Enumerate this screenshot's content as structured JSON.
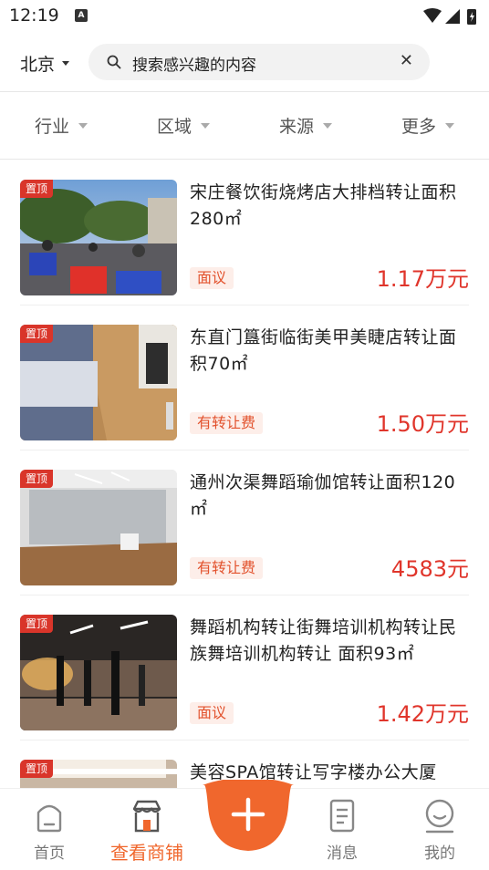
{
  "status_bar": {
    "time": "12:19",
    "notification_icon": "A"
  },
  "header": {
    "city": "北京",
    "search": {
      "value": "搜索感兴趣的内容"
    }
  },
  "filters": [
    "行业",
    "区域",
    "来源",
    "更多"
  ],
  "listings": [
    {
      "badge": "置顶",
      "title": "宋庄餐饮街烧烤店大排档转让面积280㎡",
      "tag": "面议",
      "price_num": "1.17",
      "price_unit": "万元"
    },
    {
      "badge": "置顶",
      "title": "东直门簋街临街美甲美睫店转让面积70㎡",
      "tag": "有转让费",
      "price_num": "1.50",
      "price_unit": "万元"
    },
    {
      "badge": "置顶",
      "title": "通州次渠舞蹈瑜伽馆转让面积120㎡",
      "tag": "有转让费",
      "price_num": "4583",
      "price_unit": "元"
    },
    {
      "badge": "置顶",
      "title": "舞蹈机构转让街舞培训机构转让民族舞培训机构转让 面积93㎡",
      "tag": "面议",
      "price_num": "1.42",
      "price_unit": "万元"
    },
    {
      "badge": "置顶",
      "title": "美容SPA馆转让写字楼办公大厦",
      "tag": "",
      "price_num": "",
      "price_unit": ""
    }
  ],
  "tabbar": {
    "home": "首页",
    "shops": "查看商铺",
    "messages": "消息",
    "mine": "我的"
  },
  "colors": {
    "accent": "#f0672d",
    "price": "#e0352b",
    "badge": "#d9352a"
  }
}
